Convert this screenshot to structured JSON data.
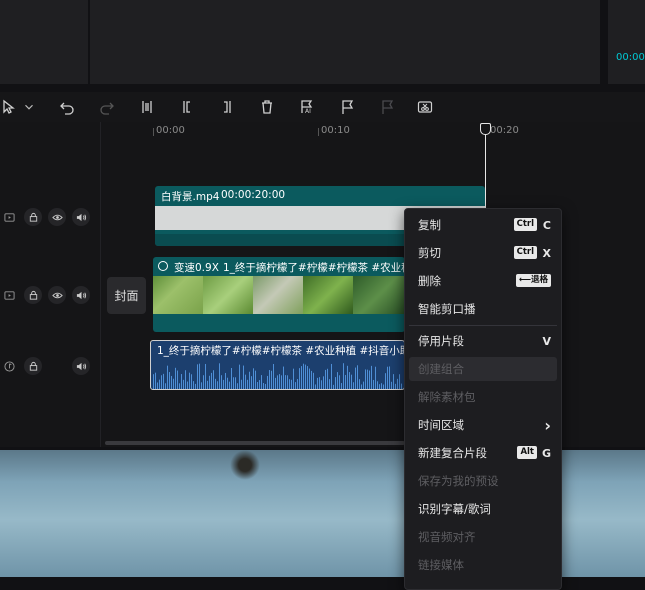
{
  "preview": {
    "timecode": "00:00"
  },
  "ruler": {
    "marks": [
      "00:00",
      "00:10",
      "00:20"
    ]
  },
  "clips": {
    "background": {
      "name": "白背景.mp4",
      "duration": "00:00:20:00"
    },
    "main": {
      "speed": "变速0.9X",
      "title": "1_终于摘柠檬了#柠檬#柠檬茶 #农业种植"
    },
    "audio": {
      "title": "1_终于摘柠檬了#柠檬#柠檬茶 #农业种植 #抖音小助手 #"
    }
  },
  "cover": {
    "label": "封面"
  },
  "context_menu": {
    "items": [
      {
        "label": "复制",
        "key": "Ctrl",
        "shortcut": "C",
        "enabled": true
      },
      {
        "label": "剪切",
        "key": "Ctrl",
        "shortcut": "X",
        "enabled": true
      },
      {
        "label": "删除",
        "key": "⟵退格",
        "shortcut": "",
        "enabled": true
      },
      {
        "label": "智能剪口播",
        "key": "",
        "shortcut": "",
        "enabled": true
      },
      {
        "label": "停用片段",
        "key": "",
        "shortcut": "V",
        "enabled": true
      },
      {
        "label": "创建组合",
        "key": "",
        "shortcut": "",
        "enabled": false
      },
      {
        "label": "解除素材包",
        "key": "",
        "shortcut": "",
        "enabled": false
      },
      {
        "label": "时间区域",
        "key": "",
        "shortcut": "›",
        "enabled": true
      },
      {
        "label": "新建复合片段",
        "key": "Alt",
        "shortcut": "G",
        "enabled": true
      },
      {
        "label": "保存为我的预设",
        "key": "",
        "shortcut": "",
        "enabled": false
      },
      {
        "label": "识别字幕/歌词",
        "key": "",
        "shortcut": "",
        "enabled": true
      },
      {
        "label": "视音频对齐",
        "key": "",
        "shortcut": "",
        "enabled": false
      },
      {
        "label": "链接媒体",
        "key": "",
        "shortcut": "",
        "enabled": false
      }
    ]
  },
  "colors": {
    "accent": "#00c8d4",
    "clip_teal": "#0b5a5e",
    "audio_blue": "#1c3f6e",
    "menu_bg": "#1d1d20"
  }
}
